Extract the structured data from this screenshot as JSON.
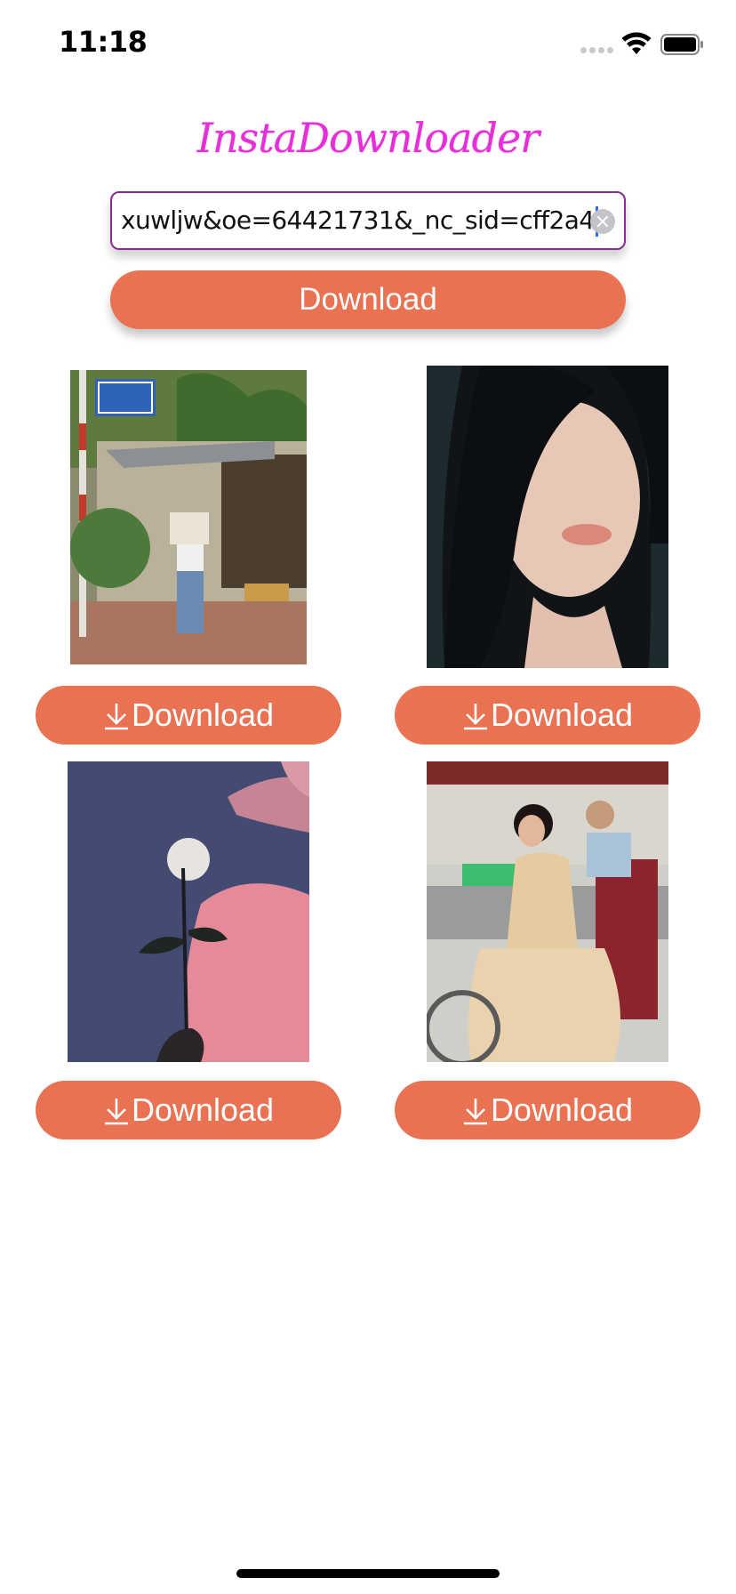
{
  "status_bar": {
    "time": "11:18"
  },
  "app": {
    "title": "InstaDownloader"
  },
  "url_input": {
    "value": "xuwljw&oe=64421731&_nc_sid=cff2a4"
  },
  "main_download_label": "Download",
  "grid": [
    {
      "download_label": "Download"
    },
    {
      "download_label": "Download"
    },
    {
      "download_label": "Download"
    },
    {
      "download_label": "Download"
    }
  ],
  "colors": {
    "accent": "#e87252",
    "title": "#e62fd8",
    "input_border": "#8a2a92"
  },
  "icons": {
    "download": "arrow-down-tray-icon",
    "clear": "clear-circle-icon"
  }
}
